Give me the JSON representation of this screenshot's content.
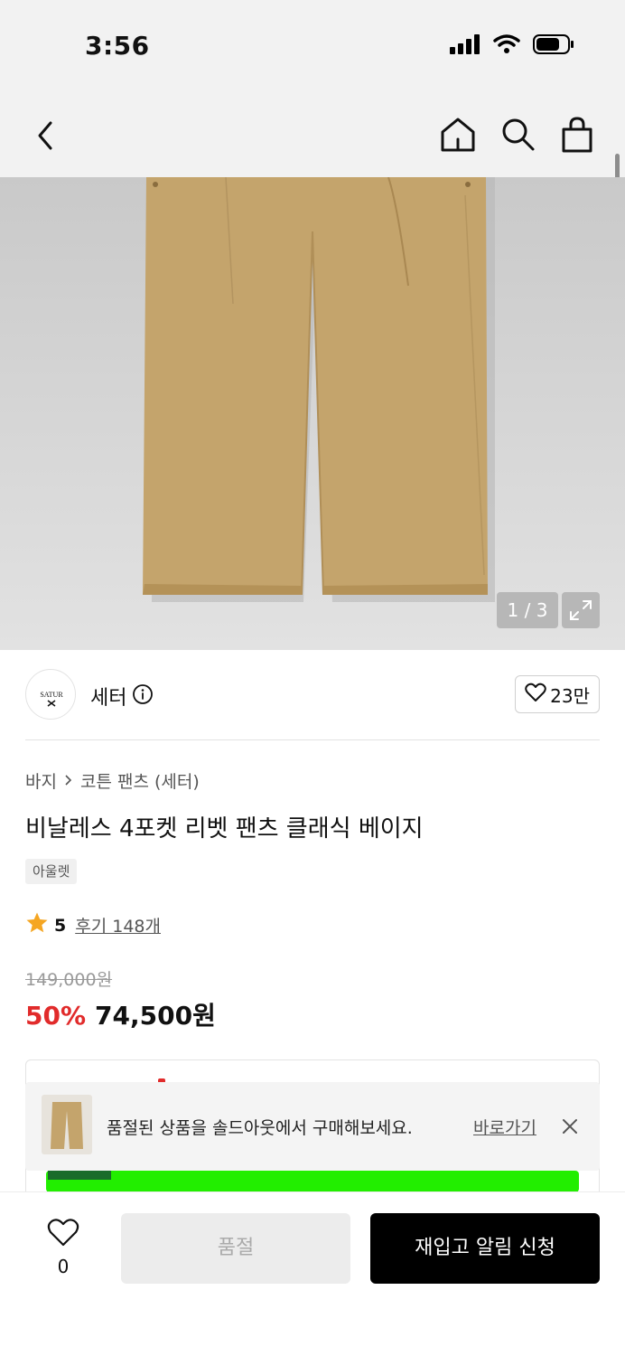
{
  "status_bar": {
    "time": "3:56"
  },
  "gallery": {
    "pager": "1 / 3"
  },
  "brand": {
    "name": "세터",
    "logo_text": "SATUR",
    "likes": "23만"
  },
  "breadcrumb": {
    "category": "바지",
    "subcategory": "코튼 팬츠 (세터)"
  },
  "product": {
    "title": "비날레스 4포켓 리벳 팬츠 클래식 베이지",
    "tag": "아울렛",
    "rating": "5",
    "reviews": "후기 148개",
    "original_price": "149,000원",
    "discount": "50%",
    "sale_price": "74,500원"
  },
  "toast": {
    "message": "품절된 상품을 솔드아웃에서 구매해보세요.",
    "link": "바로가기"
  },
  "bottom_bar": {
    "wish_count": "0",
    "soldout_label": "품절",
    "restock_label": "재입고 알림 신청"
  },
  "colors": {
    "accent_red": "#e12b2b",
    "product_beige": "#c4a46c",
    "promo_green": "#22ee00"
  }
}
